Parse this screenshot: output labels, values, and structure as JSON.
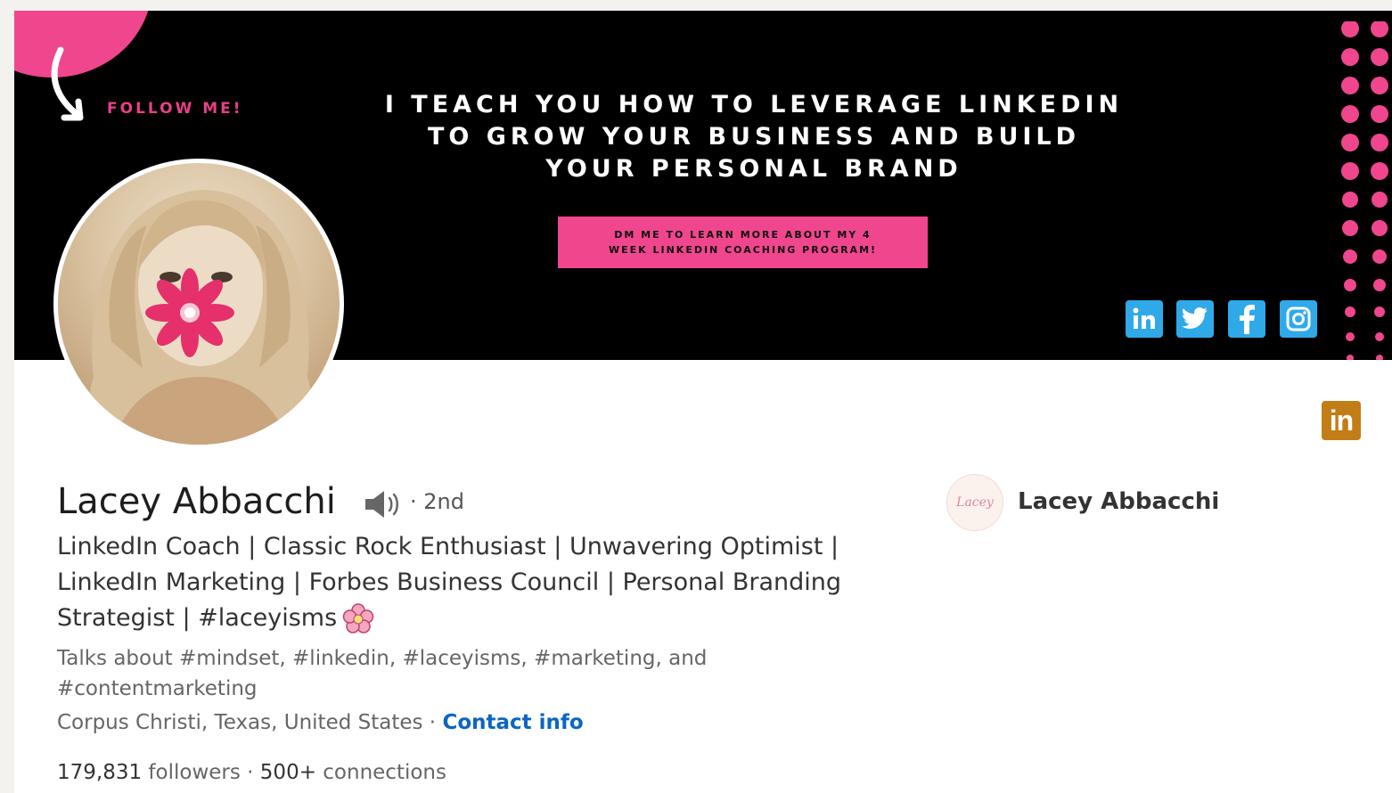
{
  "banner": {
    "follow_label": "FOLLOW ME!",
    "tagline_lines": [
      "I TEACH YOU HOW TO LEVERAGE LINKEDIN",
      "TO GROW YOUR BUSINESS AND BUILD",
      "YOUR PERSONAL BRAND"
    ],
    "cta_lines": [
      "DM ME TO LEARN MORE ABOUT MY 4",
      "WEEK LINKEDIN COACHING PROGRAM!"
    ],
    "social_icons": [
      "linkedin-icon",
      "twitter-icon",
      "facebook-icon",
      "instagram-icon"
    ],
    "colors": {
      "accent_pink": "#f0468d",
      "social_blue": "#2fa9e8",
      "background": "#000000"
    }
  },
  "profile": {
    "name": "Lacey Abbacchi",
    "degree": "· 2nd",
    "headline_lines": [
      "LinkedIn Coach | Classic Rock Enthusiast | Unwavering Optimist |",
      "LinkedIn Marketing | Forbes Business Council | Personal Branding",
      "Strategist | #laceyisms"
    ],
    "talks_about_lines": [
      "Talks about #mindset, #linkedin, #laceyisms, #marketing, and",
      "#contentmarketing"
    ],
    "location": "Corpus Christi, Texas, United States",
    "location_separator": " · ",
    "contact_info_label": "Contact info",
    "followers_count": "179,831",
    "followers_label": " followers",
    "connections_separator": "  · ",
    "connections_count": "500+",
    "connections_label": " connections"
  },
  "company": {
    "name": "Lacey Abbacchi",
    "logo_text": "Lacey"
  },
  "badge": {
    "label": "in",
    "color": "#c37d16"
  }
}
